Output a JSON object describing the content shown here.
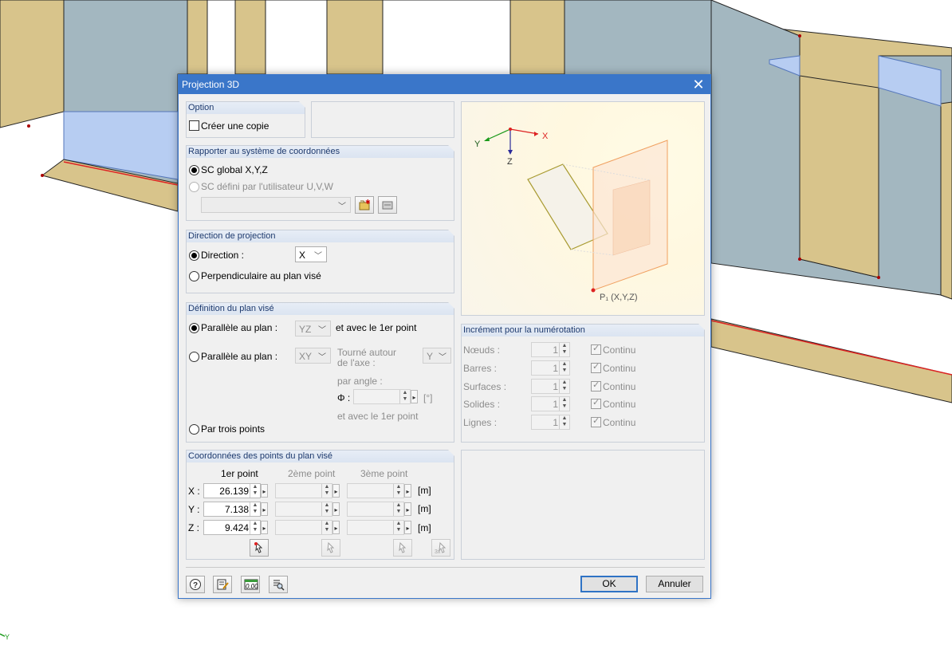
{
  "dialog": {
    "title": "Projection 3D",
    "close_glyph": "✕"
  },
  "option": {
    "header": "Option",
    "create_copy": "Créer une copie",
    "create_copy_checked": false
  },
  "coord_system": {
    "header": "Rapporter au système de coordonnées",
    "global": "SC global X,Y,Z",
    "user": "SC défini par l'utilisateur U,V,W",
    "selected": "global",
    "combo_value": ""
  },
  "projection_direction": {
    "header": "Direction de projection",
    "direction_label": "Direction :",
    "direction_value": "X",
    "perpendicular_label": "Perpendiculaire au plan visé",
    "selected": "direction"
  },
  "target_plane": {
    "header": "Définition du plan visé",
    "parallel1_label": "Parallèle au plan :",
    "parallel1_value": "YZ",
    "parallel1_suffix": "et avec le 1er point",
    "parallel2_label": "Parallèle au plan :",
    "parallel2_value": "XY",
    "rotated_axis_label_line1": "Tourné autour",
    "rotated_axis_label_line2": "de l'axe :",
    "axis_value": "Y",
    "angle_label": "par angle :",
    "phi_label": "Φ :",
    "angle_value": "",
    "angle_unit": "[°]",
    "and_first_point": "et avec le 1er point",
    "three_points_label": "Par trois points",
    "selected": "parallel1"
  },
  "coords": {
    "header": "Coordonnées des points du plan visé",
    "col1": "1er point",
    "col2": "2ème point",
    "col3": "3ème point",
    "rows": [
      {
        "axis": "X :",
        "p1": "26.139",
        "p2": "",
        "p3": "",
        "unit": "[m]"
      },
      {
        "axis": "Y :",
        "p1": "7.138",
        "p2": "",
        "p3": "",
        "unit": "[m]"
      },
      {
        "axis": "Z :",
        "p1": "9.424",
        "p2": "",
        "p3": "",
        "unit": "[m]"
      }
    ]
  },
  "preview": {
    "axis_x": "X",
    "axis_y": "Y",
    "axis_z": "Z",
    "point_label": "P₁ (X,Y,Z)"
  },
  "increment": {
    "header": "Incrément pour la numérotation",
    "continuous_label": "Continu",
    "rows": [
      {
        "label": "Nœuds :",
        "value": "1",
        "continuous": true
      },
      {
        "label": "Barres :",
        "value": "1",
        "continuous": true
      },
      {
        "label": "Surfaces :",
        "value": "1",
        "continuous": true
      },
      {
        "label": "Solides :",
        "value": "1",
        "continuous": true
      },
      {
        "label": "Lignes :",
        "value": "1",
        "continuous": true
      }
    ]
  },
  "footer": {
    "ok": "OK",
    "cancel": "Annuler",
    "units_icon_text": "0.00"
  },
  "viewport": {
    "axis_label": "Y"
  },
  "colors": {
    "titlebar": "#3a76c9",
    "wall_tan": "#d8c48b",
    "wall_blue": "#a3b7c0",
    "glass_blue": "#b7cdf2"
  }
}
